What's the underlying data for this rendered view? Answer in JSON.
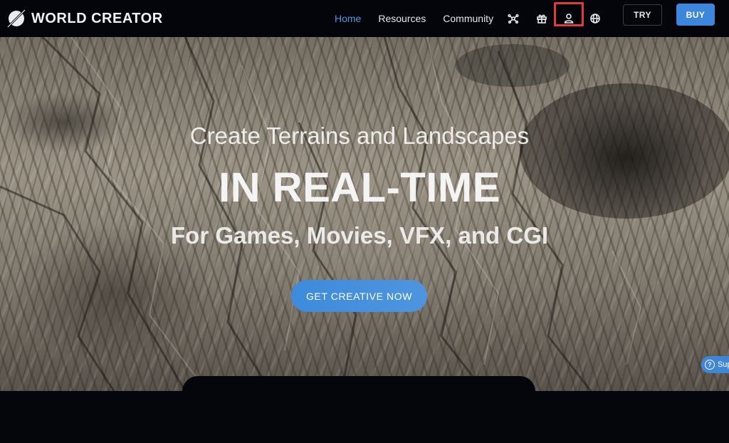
{
  "brand": {
    "name": "WORLD CREATOR",
    "logo_icon": "planet-slash-icon"
  },
  "nav": {
    "links": [
      {
        "label": "Home",
        "active": true
      },
      {
        "label": "Resources",
        "active": false
      },
      {
        "label": "Community",
        "active": false
      }
    ],
    "icons": [
      "network-icon",
      "gift-icon",
      "user-icon",
      "globe-icon"
    ],
    "highlighted_icon": "user-icon",
    "try_label": "TRY",
    "buy_label": "BUY"
  },
  "hero": {
    "subtitle_top": "Create Terrains and Landscapes",
    "title": "IN REAL-TIME",
    "subtitle_bottom": "For Games, Movies, VFX, and CGI",
    "cta_label": "GET CREATIVE NOW"
  },
  "support": {
    "label": "Sup",
    "icon": "question-circle-icon"
  },
  "colors": {
    "accent": "#3c87db",
    "active_link": "#4a9be0",
    "highlight_box": "#e03a3a",
    "background": "#05060a"
  }
}
